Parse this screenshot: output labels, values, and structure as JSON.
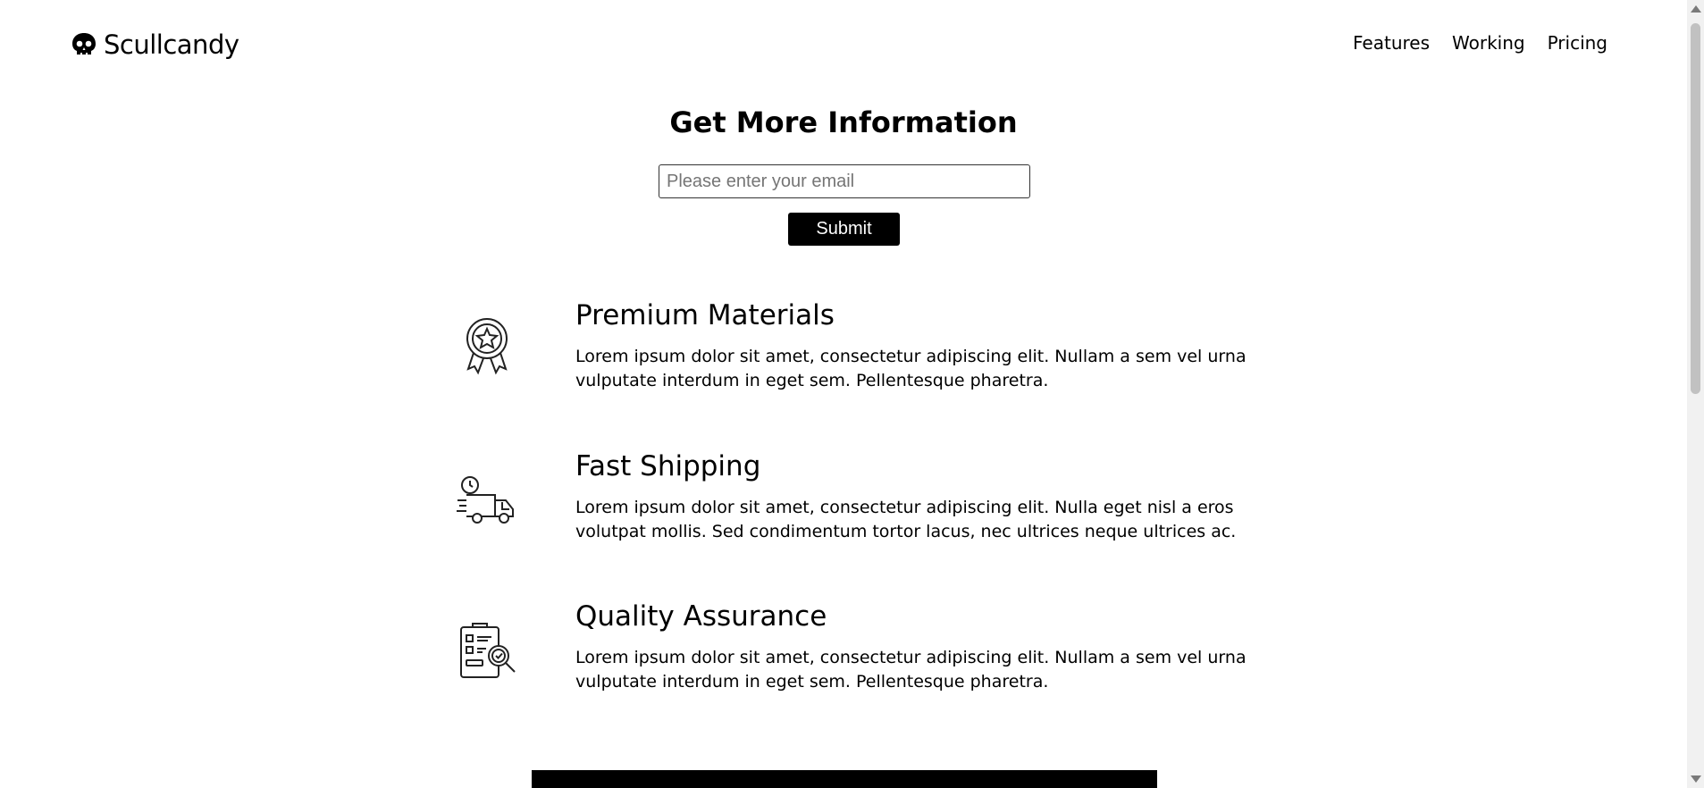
{
  "brand": {
    "name": "Scullcandy",
    "logo_icon": "skull-icon"
  },
  "nav": {
    "items": [
      "Features",
      "Working",
      "Pricing"
    ]
  },
  "hero": {
    "title": "Get More Information",
    "email_placeholder": "Please enter your email",
    "submit_label": "Submit"
  },
  "features": [
    {
      "icon": "award-ribbon-icon",
      "title": "Premium Materials",
      "text": "Lorem ipsum dolor sit amet, consectetur adipiscing elit. Nullam a sem vel urna vulputate interdum in eget sem. Pellentesque pharetra."
    },
    {
      "icon": "delivery-truck-icon",
      "title": "Fast Shipping",
      "text": "Lorem ipsum dolor sit amet, consectetur adipiscing elit. Nulla eget nisl a eros volutpat mollis. Sed condimentum tortor lacus, nec ultrices neque ultrices ac."
    },
    {
      "icon": "clipboard-check-icon",
      "title": "Quality Assurance",
      "text": "Lorem ipsum dolor sit amet, consectetur adipiscing elit. Nullam a sem vel urna vulputate interdum in eget sem. Pellentesque pharetra."
    }
  ]
}
